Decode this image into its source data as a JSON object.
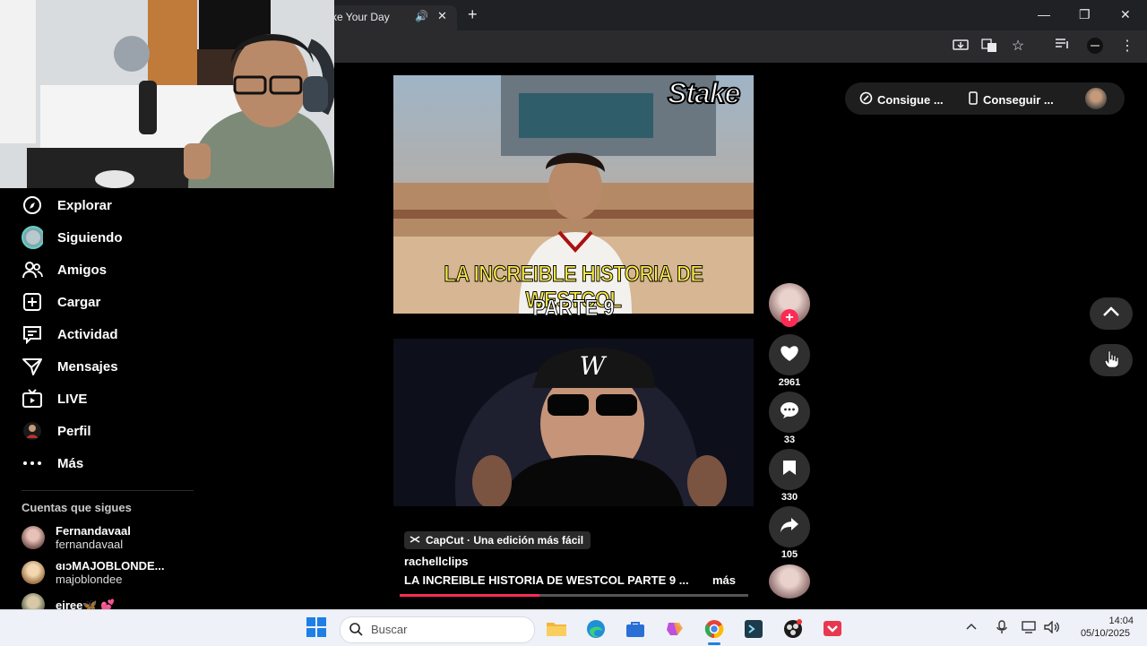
{
  "browser": {
    "tab_title": "ke Your Day",
    "new_tab": "+",
    "close_tab": "✕",
    "window_minimize": "—",
    "window_restore": "❐",
    "window_close": "✕"
  },
  "sidebar": {
    "items": [
      {
        "label": "Explorar",
        "icon": "compass-icon"
      },
      {
        "label": "Siguiendo",
        "icon": "following-avatar-icon"
      },
      {
        "label": "Amigos",
        "icon": "friends-icon"
      },
      {
        "label": "Cargar",
        "icon": "upload-icon"
      },
      {
        "label": "Actividad",
        "icon": "activity-icon"
      },
      {
        "label": "Mensajes",
        "icon": "messages-icon"
      },
      {
        "label": "LIVE",
        "icon": "live-icon"
      },
      {
        "label": "Perfil",
        "icon": "profile-avatar-icon"
      },
      {
        "label": "Más",
        "icon": "more-dots-icon"
      }
    ],
    "following_title": "Cuentas que sigues",
    "accounts": [
      {
        "name": "Fernandavaal",
        "handle": "fernandavaal"
      },
      {
        "name": "ɞıɔMAJOBLONDE...",
        "handle": "majoblondee"
      },
      {
        "name": "eiree🦋 💕",
        "handle": ""
      }
    ]
  },
  "video": {
    "stake_logo": "Stake",
    "title_line1": "LA INCREIBLE HISTORIA DE WESTCOL",
    "title_line2": "PARTE 9",
    "capcut": "CapCut · Una edición más fácil",
    "author": "rachellclips",
    "description": "LA INCREIBLE HISTORIA DE WESTCOL PARTE 9 ...",
    "more": "más",
    "progress": 0.4
  },
  "actions": {
    "likes": "2961",
    "comments": "33",
    "saves": "330",
    "shares": "105",
    "follow": "+"
  },
  "top_right": {
    "coins": "Consigue ...",
    "app": "Conseguir ..."
  },
  "taskbar": {
    "search_placeholder": "Buscar",
    "time": "14:04",
    "date": "05/10/2025"
  },
  "colors": {
    "accent": "#fe2c55",
    "background": "#000000",
    "caption_yellow": "#f7e84a"
  }
}
